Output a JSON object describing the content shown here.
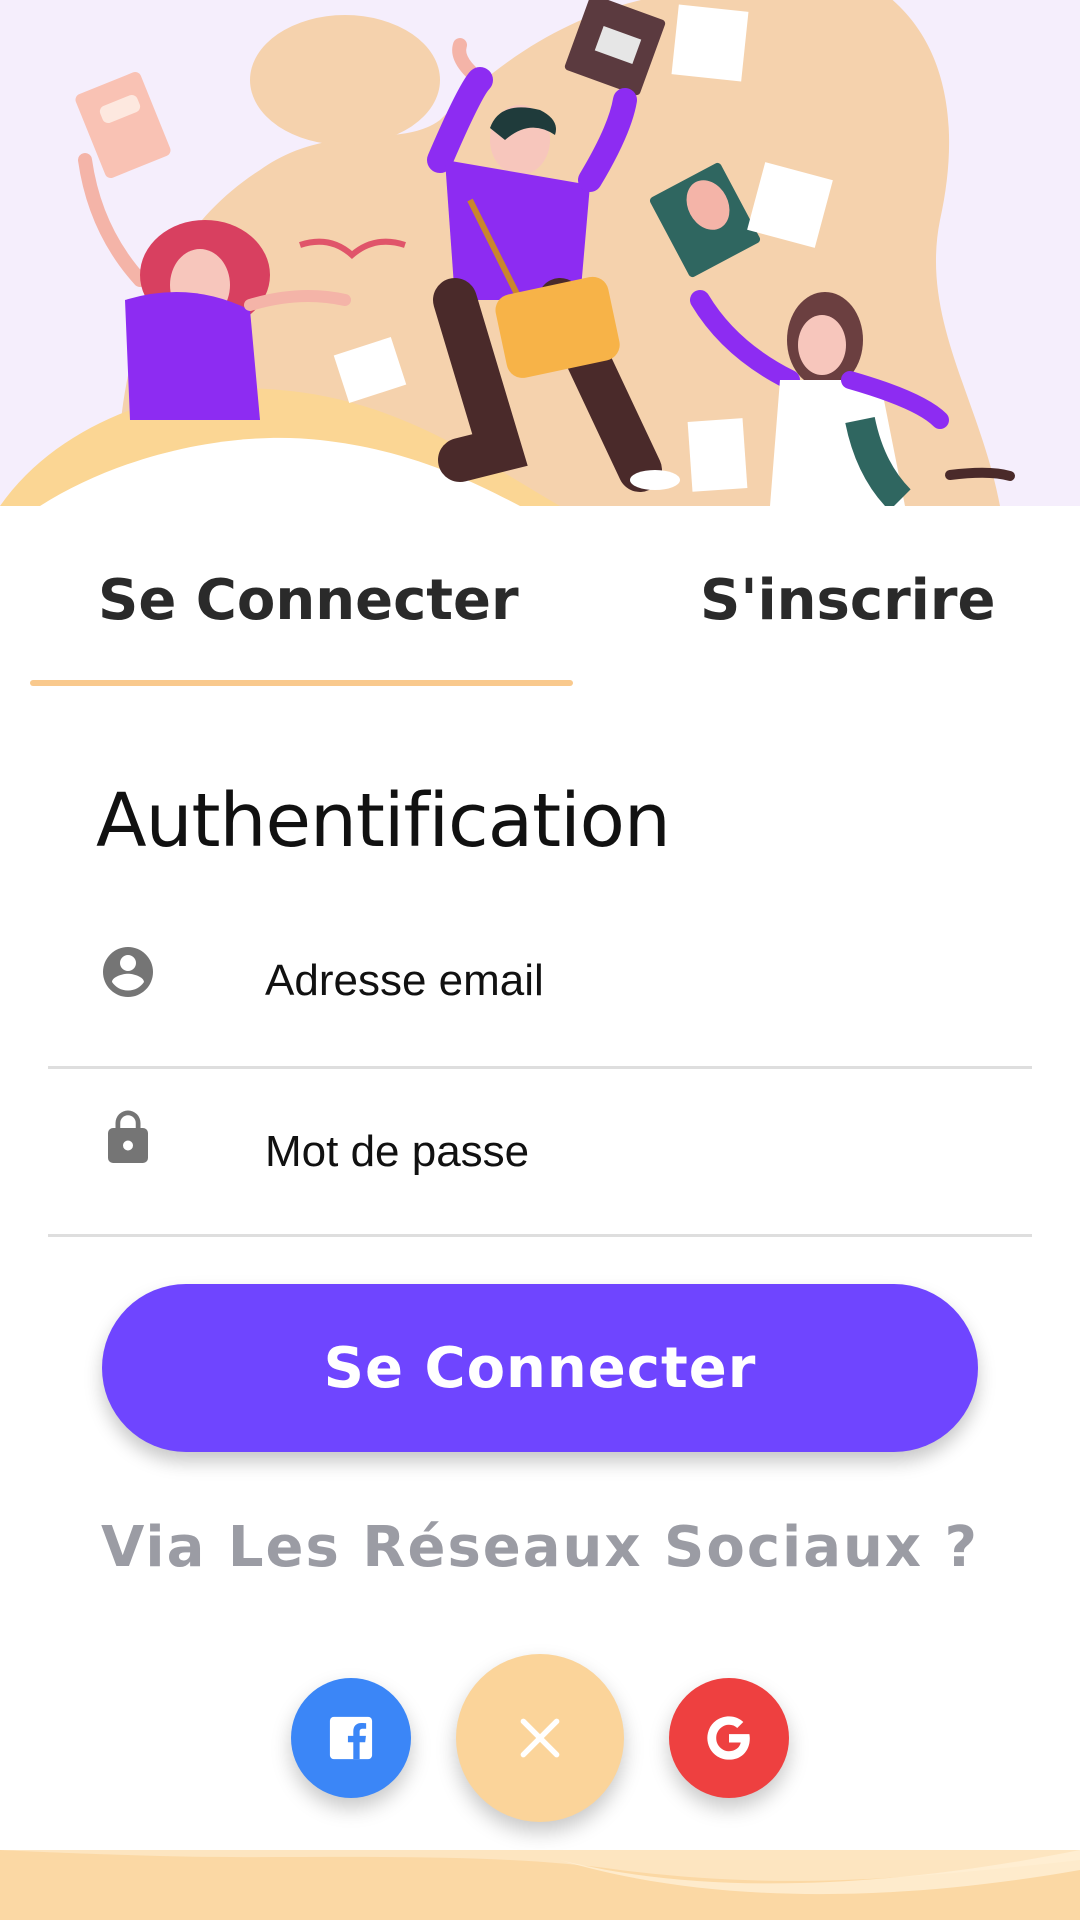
{
  "tabs": {
    "login": "Se Connecter",
    "register": "S'inscrire",
    "active": "login"
  },
  "form": {
    "title": "Authentification",
    "email": {
      "placeholder": "Adresse email",
      "icon": "account-circle-icon"
    },
    "password": {
      "placeholder": "Mot de passe",
      "icon": "lock-icon"
    },
    "submit_label": "Se Connecter"
  },
  "social": {
    "label": "Via Les Réseaux Sociaux ?",
    "buttons": [
      {
        "name": "facebook",
        "icon": "facebook-icon",
        "color": "#3b86f7"
      },
      {
        "name": "close",
        "icon": "close-icon",
        "color": "#fbd49a"
      },
      {
        "name": "google",
        "icon": "google-icon",
        "color": "#ee4040"
      }
    ]
  },
  "colors": {
    "primary": "#6f45ff",
    "accent": "#f9c98d",
    "hero_background": "#f5eefc",
    "muted_text": "#9b9ca4"
  }
}
